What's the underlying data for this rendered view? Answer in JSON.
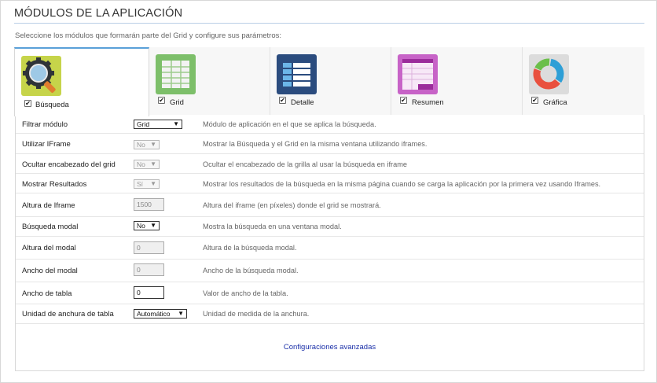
{
  "header": {
    "title": "MÓDULOS DE LA APLICACIÓN",
    "subtitle": "Seleccione los módulos que formarán parte del Grid y configure sus parámetros:"
  },
  "tabs": [
    {
      "label": "Búsqueda",
      "checked": true,
      "active": true,
      "icon": "magnifier-gear-icon",
      "color": "#c6d44a"
    },
    {
      "label": "Grid",
      "checked": true,
      "active": false,
      "icon": "grid-table-icon",
      "color": "#7dbf6a"
    },
    {
      "label": "Detalle",
      "checked": true,
      "active": false,
      "icon": "detail-list-icon",
      "color": "#2b4c7e"
    },
    {
      "label": "Resumen",
      "checked": true,
      "active": false,
      "icon": "summary-table-icon",
      "color": "#c763c7"
    },
    {
      "label": "Gráfica",
      "checked": true,
      "active": false,
      "icon": "donut-chart-icon",
      "color": "#d8d8d8"
    }
  ],
  "settings": [
    {
      "label": "Filtrar módulo",
      "control": "select",
      "value": "Grid",
      "enabled": true,
      "description": "Módulo de aplicación en el que se aplica la búsqueda."
    },
    {
      "label": "Utilizar IFrame",
      "control": "select",
      "value": "No",
      "enabled": false,
      "description": "Mostrar la Búsqueda y el Grid en la misma ventana utilizando iframes."
    },
    {
      "label": "Ocultar encabezado del grid",
      "control": "select",
      "value": "No",
      "enabled": false,
      "description": "Ocultar el encabezado de la grilla al usar la búsqueda en iframe"
    },
    {
      "label": "Mostrar Resultados",
      "control": "select",
      "value": "Sí",
      "enabled": false,
      "description": "Mostrar los resultados de la búsqueda en la misma página cuando se carga la aplicación por la primera vez usando Iframes."
    },
    {
      "label": "Altura de Iframe",
      "control": "input",
      "value": "1500",
      "enabled": false,
      "description": "Altura del iframe (en píxeles) donde el grid se mostrará."
    },
    {
      "label": "Búsqueda modal",
      "control": "select",
      "value": "No",
      "enabled": true,
      "description": "Mostra la búsqueda en una ventana modal."
    },
    {
      "label": "Altura del modal",
      "control": "input",
      "value": "0",
      "enabled": false,
      "description": "Altura de la búsqueda modal."
    },
    {
      "label": "Ancho del modal",
      "control": "input",
      "value": "0",
      "enabled": false,
      "description": "Ancho de la búsqueda modal."
    },
    {
      "label": "Ancho de tabla",
      "control": "input",
      "value": "0",
      "enabled": true,
      "description": "Valor de ancho de la tabla."
    },
    {
      "label": "Unidad de anchura de tabla",
      "control": "select",
      "value": "Automático",
      "enabled": true,
      "description": "Unidad de medida de la anchura."
    }
  ],
  "advanced_link": "Configuraciones avanzadas",
  "check_glyph": "✔",
  "arrow_glyph": "▼"
}
